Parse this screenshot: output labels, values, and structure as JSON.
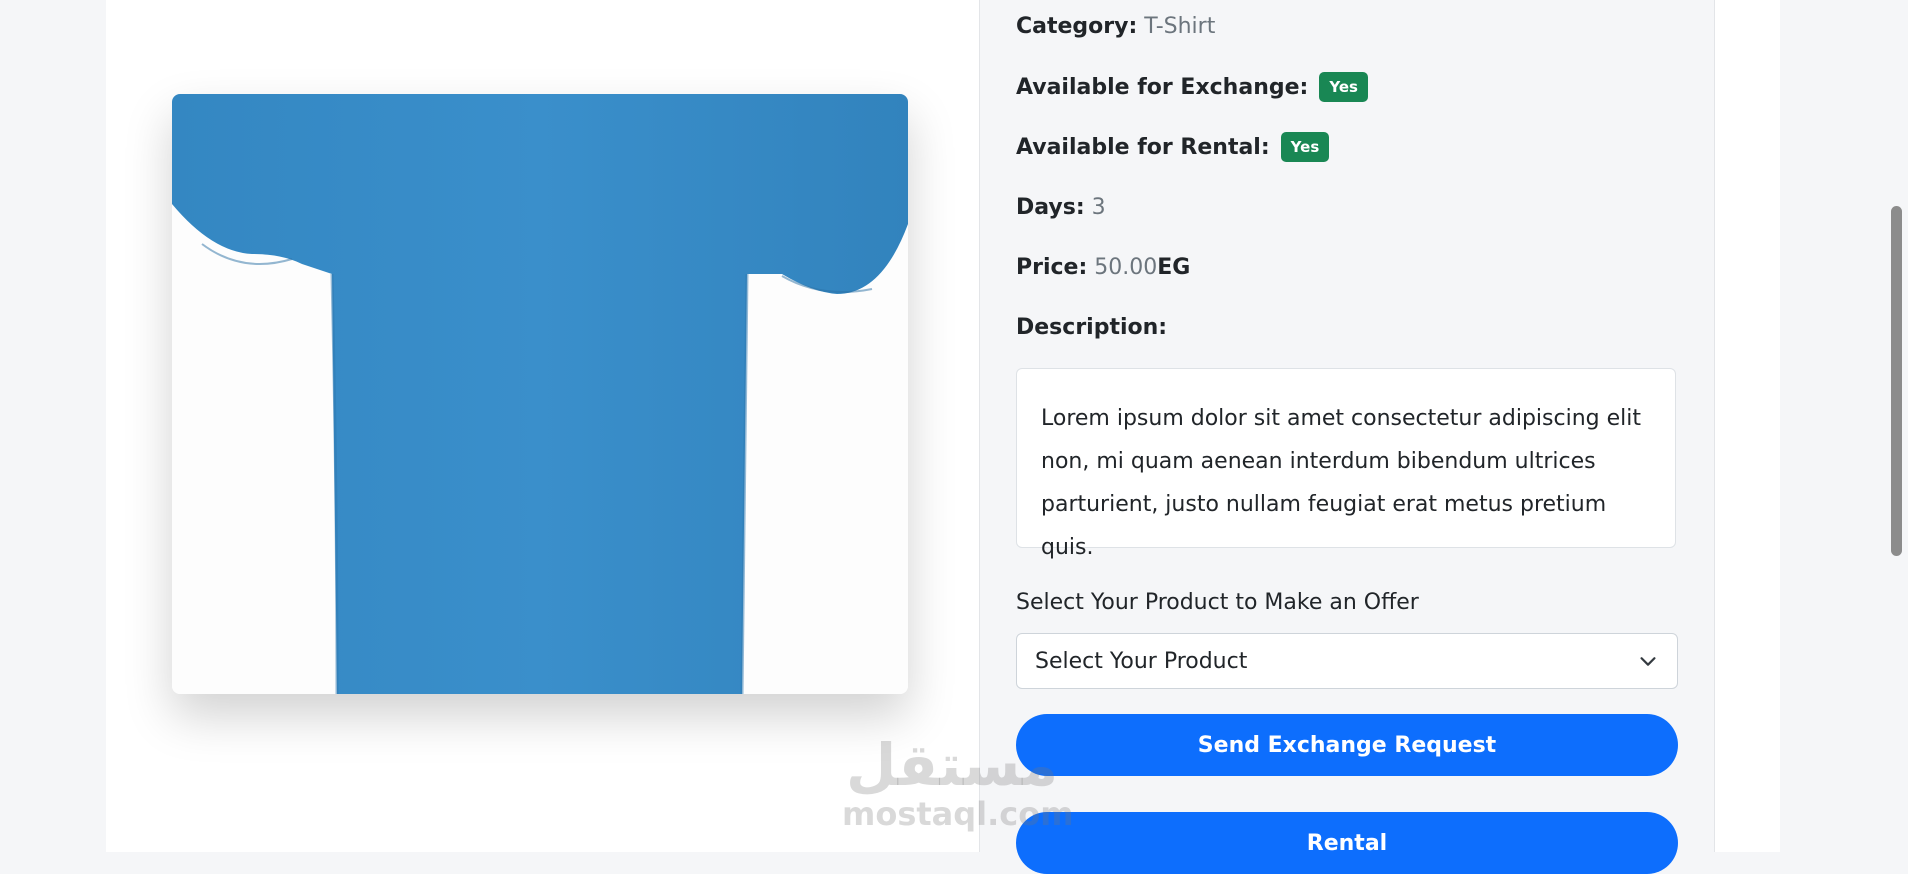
{
  "product": {
    "category_label": "Category:",
    "category_value": "T-Shirt",
    "exchange_label": "Available for Exchange:",
    "exchange_badge": "Yes",
    "rental_label": "Available for Rental:",
    "rental_badge": "Yes",
    "days_label": "Days:",
    "days_value": "3",
    "price_label": "Price:",
    "price_value": "50.00",
    "price_currency": "EG",
    "description_label": "Description:",
    "description_text": "Lorem ipsum dolor sit amet consectetur adipiscing elit non, mi quam aenean interdum bibendum ultrices parturient, justo nullam feugiat erat metus pretium quis.",
    "image_color": "#3a8fcb"
  },
  "offer": {
    "select_label": "Select Your Product to Make an Offer",
    "select_value": "Select Your Product",
    "exchange_button": "Send Exchange Request",
    "rental_button": "Rental"
  },
  "watermark": {
    "arabic": "مستقل",
    "latin": "mostaql.com"
  },
  "colors": {
    "badge_success": "#198754",
    "primary": "#0d6efd"
  }
}
